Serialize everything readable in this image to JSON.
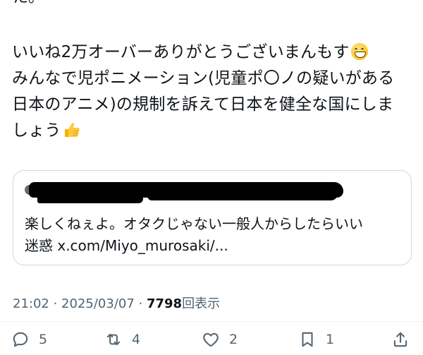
{
  "tweet": {
    "cut_top_text": "た。",
    "lines": [
      "いいね2万オーバーありがとうございまんもす",
      "みんなで児ポニメーション(児童ポ〇ノの疑いがある",
      "日本のアニメ)の規制を訴えて日本を健全な国にしま",
      "しょう"
    ],
    "emoji_1": "grinning-face-emoji",
    "emoji_2": "thumbs-up-emoji"
  },
  "quote_card": {
    "author_redacted": true,
    "lines": [
      "楽しくねぇよ。オタクじゃない一般人からしたらいい",
      "迷惑 x.com/Miyo_murosaki/..."
    ]
  },
  "meta": {
    "time": "21:02",
    "separator": " · ",
    "date": "2025/03/07",
    "views": "7798",
    "views_label": "回表示"
  },
  "actions": {
    "reply": {
      "icon": "reply-icon",
      "count": "5"
    },
    "repost": {
      "icon": "repost-icon",
      "count": "4"
    },
    "like": {
      "icon": "heart-icon",
      "count": "2"
    },
    "bookmark": {
      "icon": "bookmark-icon",
      "count": "1"
    },
    "share": {
      "icon": "share-icon"
    }
  },
  "colors": {
    "text": "#0f1419",
    "secondary": "#536471",
    "border": "#cfd9de"
  }
}
